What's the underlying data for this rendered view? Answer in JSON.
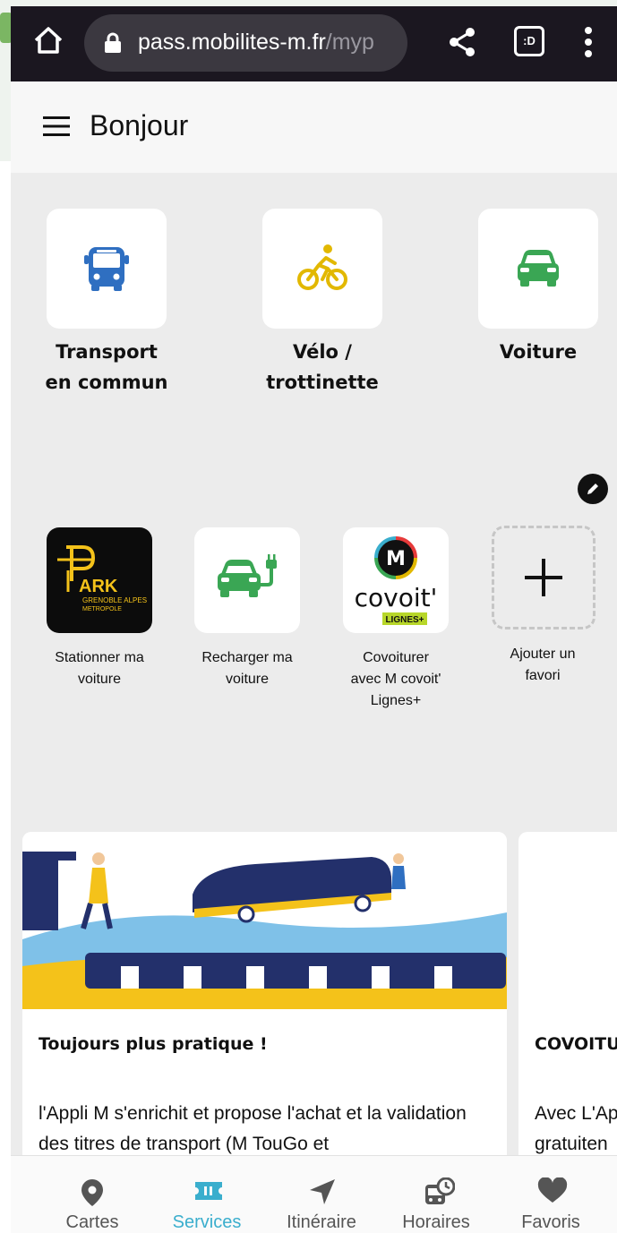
{
  "browser": {
    "url_host": "pass.mobilites-m.fr",
    "url_path": "/myp",
    "tab_badge": ":D"
  },
  "header": {
    "title": "Bonjour"
  },
  "modes": [
    {
      "line1": "Transport",
      "line2": "en commun",
      "icon": "bus-icon",
      "color": "#2f6fc1"
    },
    {
      "line1": "Vélo /",
      "line2": "trottinette",
      "icon": "bike-icon",
      "color": "#e2b800"
    },
    {
      "line1": "Voiture",
      "line2": "",
      "icon": "car-icon",
      "color": "#3aa654"
    }
  ],
  "favorites": [
    {
      "line1": "Stationner ma",
      "line2": "voiture",
      "line3": "",
      "logo_text": "ARK",
      "logo_sub1": "GRENOBLE ALPES",
      "logo_sub2": "METROPOLE"
    },
    {
      "line1": "Recharger ma",
      "line2": "voiture",
      "line3": ""
    },
    {
      "line1": "Covoiturer",
      "line2": "avec M covoit'",
      "line3": "Lignes+",
      "logo_m": "M",
      "logo_word": "covoit'",
      "logo_tag": "LIGNES+"
    },
    {
      "line1": "Ajouter un",
      "line2": "favori",
      "line3": ""
    }
  ],
  "news": [
    {
      "title": "Toujours plus pratique !",
      "body": "l'Appli M s'enrichit et propose l'achat et la validation des titres de transport (M TouGo et"
    },
    {
      "title": "COVOITU",
      "body": "Avec L'Ap gratuiten"
    }
  ],
  "bottom_nav": [
    {
      "label": "Cartes",
      "icon": "map-pin-icon",
      "active": false
    },
    {
      "label": "Services",
      "icon": "ticket-icon",
      "active": true
    },
    {
      "label": "Itinéraire",
      "icon": "navigation-arrow-icon",
      "active": false
    },
    {
      "label": "Horaires",
      "icon": "bus-clock-icon",
      "active": false
    },
    {
      "label": "Favoris",
      "icon": "heart-icon",
      "active": false
    }
  ],
  "colors": {
    "accent": "#3aaecd",
    "browser_bar": "#1b1720",
    "background": "#ececec"
  }
}
